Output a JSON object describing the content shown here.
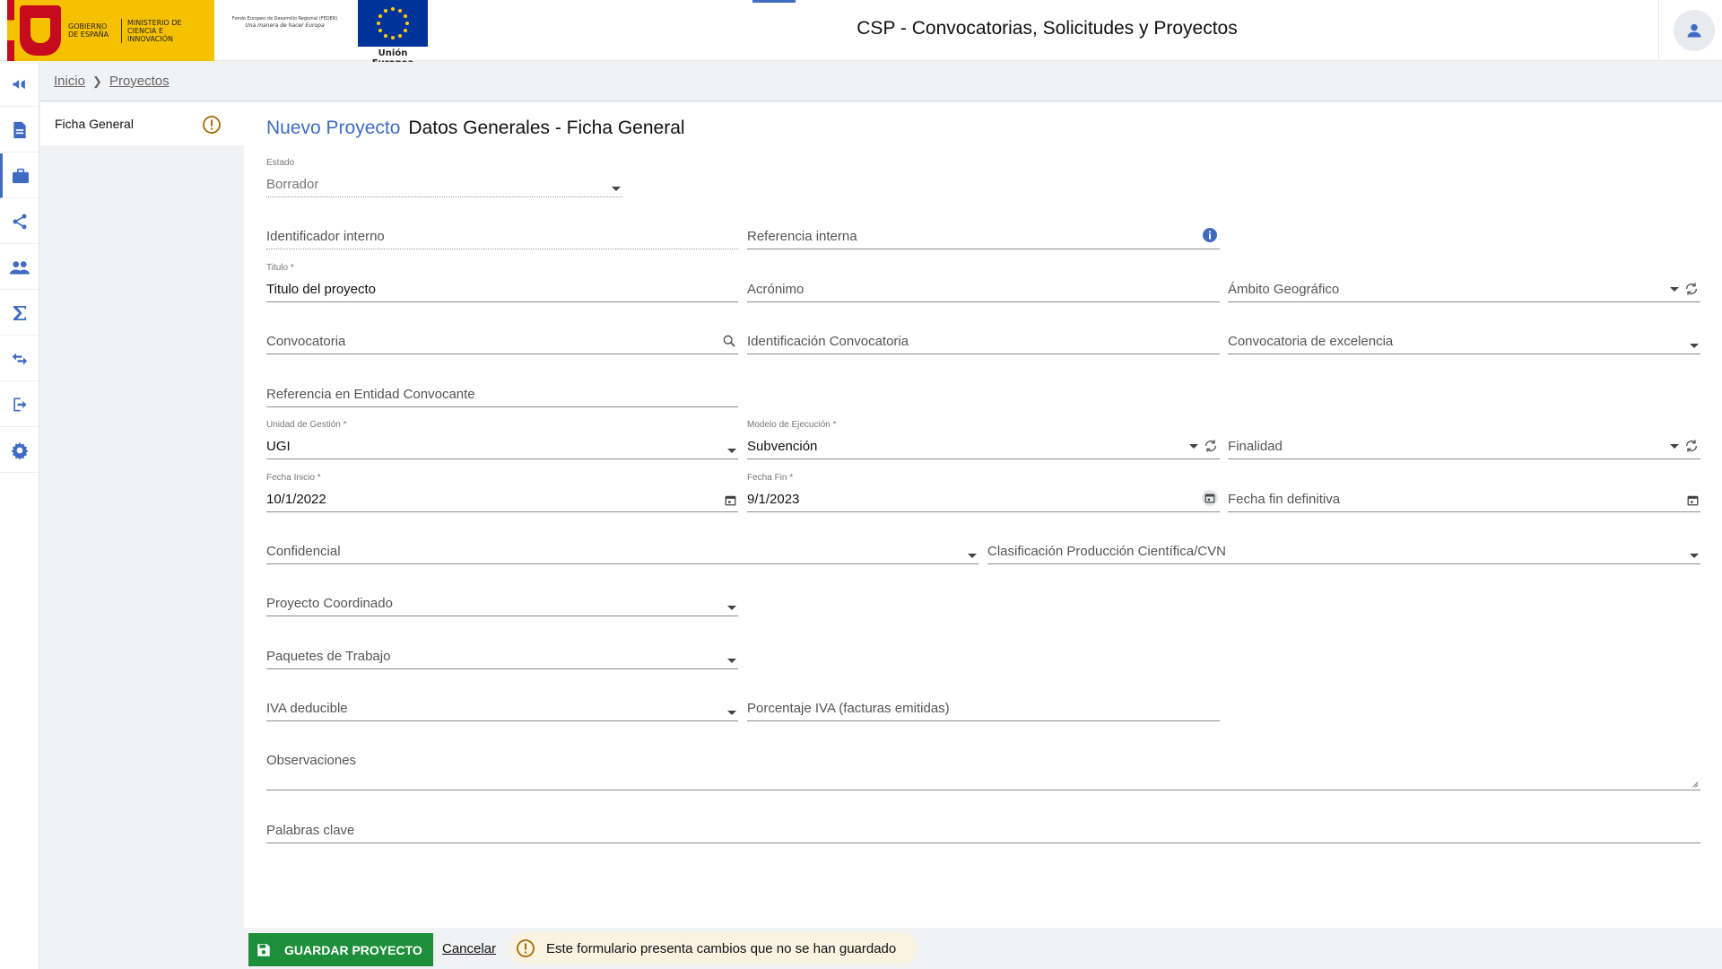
{
  "header": {
    "gov_text": "Gobierno de España",
    "ministry_text": "Ministerio de Ciencia e Innovación",
    "feder_text": "Fondo Europeo de Desarrollo Regional (FEDER)",
    "feder_slogan": "Una manera de hacer Europa",
    "eu_caption": "Unión Europea",
    "title": "CSP - Convocatorias, Solicitudes y Proyectos",
    "user_icon": "user-icon"
  },
  "rail": {
    "items": [
      {
        "icon": "megaphone-icon"
      },
      {
        "icon": "document-icon"
      },
      {
        "icon": "briefcase-icon"
      },
      {
        "icon": "share-icon"
      },
      {
        "icon": "people-icon"
      },
      {
        "icon": "sigma-icon"
      },
      {
        "icon": "swap-icon"
      },
      {
        "icon": "logout-icon"
      },
      {
        "icon": "gear-icon"
      }
    ],
    "active_index": 2
  },
  "breadcrumb": {
    "home": "Inicio",
    "current": "Proyectos"
  },
  "subnav": {
    "item_label": "Ficha General"
  },
  "page": {
    "title_accent": "Nuevo Proyecto",
    "title_rest": "Datos Generales - Ficha General"
  },
  "form": {
    "estado": {
      "label": "Estado",
      "value": "Borrador"
    },
    "identificador_interno": {
      "placeholder": "Identificador interno"
    },
    "referencia_interna": {
      "placeholder": "Referencia interna"
    },
    "titulo": {
      "label": "Titulo *",
      "value": "Titulo del proyecto"
    },
    "acronimo": {
      "placeholder": "Acrónimo"
    },
    "ambito_geografico": {
      "placeholder": "Ámbito Geográfico"
    },
    "convocatoria": {
      "placeholder": "Convocatoria"
    },
    "identificacion_convocatoria": {
      "placeholder": "Identificación Convocatoria"
    },
    "convocatoria_excelencia": {
      "placeholder": "Convocatoria de excelencia"
    },
    "referencia_entidad": {
      "placeholder": "Referencia en Entidad Convocante"
    },
    "unidad_gestion": {
      "label": "Unidad de Gestión *",
      "value": "UGI"
    },
    "modelo_ejecucion": {
      "label": "Modelo de Ejecución *",
      "value": "Subvención"
    },
    "finalidad": {
      "placeholder": "Finalidad"
    },
    "fecha_inicio": {
      "label": "Fecha Inicio *",
      "value": "10/1/2022"
    },
    "fecha_fin": {
      "label": "Fecha Fin *",
      "value": "9/1/2023"
    },
    "fecha_fin_definitiva": {
      "placeholder": "Fecha fin definitiva"
    },
    "confidencial": {
      "placeholder": "Confidencial"
    },
    "clasificacion_cvn": {
      "placeholder": "Clasificación Producción Científica/CVN"
    },
    "proyecto_coordinado": {
      "placeholder": "Proyecto Coordinado"
    },
    "paquetes_trabajo": {
      "placeholder": "Paquetes de Trabajo"
    },
    "iva_deducible": {
      "placeholder": "IVA deducible"
    },
    "porcentaje_iva": {
      "placeholder": "Porcentaje IVA (facturas emitidas)"
    },
    "observaciones": {
      "placeholder": "Observaciones"
    },
    "palabras_clave": {
      "placeholder": "Palabras clave"
    }
  },
  "footer": {
    "save_label": "GUARDAR PROYECTO",
    "cancel_label": "Cancelar",
    "unsaved_message": "Este formulario presenta cambios que no se han guardado"
  },
  "colors": {
    "accent": "#3f6cc2",
    "save_button": "#1d8f3a",
    "warning": "#a36b00",
    "info": "#3f6cc2",
    "unsaved_bg": "#fbf3e1"
  }
}
